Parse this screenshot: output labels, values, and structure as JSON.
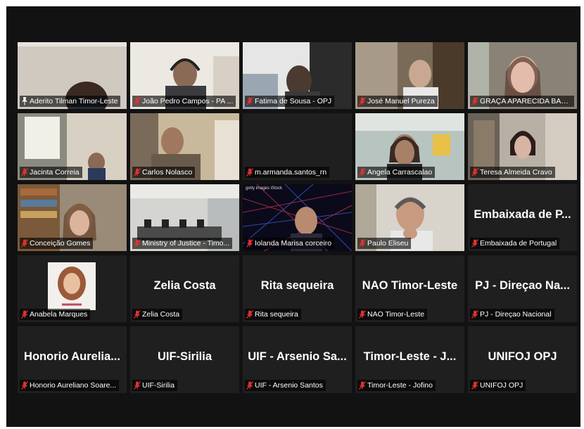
{
  "participants": [
    {
      "name": "Aderito Tilman Timor-Leste",
      "type": "video",
      "mic": "pinned",
      "active": true
    },
    {
      "name": "João Pedro Campos - PA ...",
      "type": "video",
      "mic": "muted"
    },
    {
      "name": "Fatima de Sousa - OPJ",
      "type": "video",
      "mic": "muted"
    },
    {
      "name": "José Manuel Pureza",
      "type": "video",
      "mic": "muted"
    },
    {
      "name": "GRAÇA APARECIDA BARC...",
      "type": "video",
      "mic": "muted"
    },
    {
      "name": "Jacinta Correia",
      "type": "video",
      "mic": "muted"
    },
    {
      "name": "Carlos Nolasco",
      "type": "video",
      "mic": "muted"
    },
    {
      "name": "m.armanda.santos_rn",
      "type": "blank",
      "mic": "muted"
    },
    {
      "name": "Angela Carrascalao",
      "type": "video",
      "mic": "muted"
    },
    {
      "name": "Teresa Almeida Cravo",
      "type": "video",
      "mic": "muted"
    },
    {
      "name": "Conceição Gomes",
      "type": "video",
      "mic": "muted"
    },
    {
      "name": "Ministry of Justice - Timo...",
      "type": "video",
      "mic": "muted"
    },
    {
      "name": "Iolanda Marisa corceiro",
      "type": "video",
      "mic": "muted",
      "logo": "getty images iStock"
    },
    {
      "name": "Paulo Eliseu",
      "type": "video",
      "mic": "muted"
    },
    {
      "name": "Embaixada de Portugal",
      "type": "text",
      "display": "Embaixada de P...",
      "mic": "muted"
    },
    {
      "name": "Anabela Marques",
      "type": "photo",
      "mic": "muted"
    },
    {
      "name": "Zelia Costa",
      "type": "text",
      "display": "Zelia Costa",
      "mic": "muted"
    },
    {
      "name": "Rita sequeira",
      "type": "text",
      "display": "Rita sequeira",
      "mic": "muted"
    },
    {
      "name": "NAO Timor-Leste",
      "type": "text",
      "display": "NAO Timor-Leste",
      "mic": "muted"
    },
    {
      "name": "PJ - Direçao Nacional",
      "type": "text",
      "display": "PJ - Direçao Na...",
      "mic": "muted"
    },
    {
      "name": "Honorio Aureliano Soare...",
      "type": "text",
      "display": "Honorio Aurelia...",
      "mic": "muted"
    },
    {
      "name": "UIF-Sirilia",
      "type": "text",
      "display": "UIF-Sirilia",
      "mic": "muted"
    },
    {
      "name": "UIF - Arsenio Santos",
      "type": "text",
      "display": "UIF - Arsenio Sa...",
      "mic": "muted"
    },
    {
      "name": "Timor-Leste - Jofino",
      "type": "text",
      "display": "Timor-Leste - J...",
      "mic": "muted"
    },
    {
      "name": "UNIFOJ OPJ",
      "type": "text",
      "display": "UNIFOJ OPJ",
      "mic": "muted"
    }
  ],
  "colors": {
    "active_border": "#b6d84a",
    "muted_icon": "#e0312f",
    "background": "#121212",
    "tile": "#1f1f1f"
  },
  "icons": {
    "muted": "mic-muted-icon",
    "pinned": "pin-icon"
  }
}
